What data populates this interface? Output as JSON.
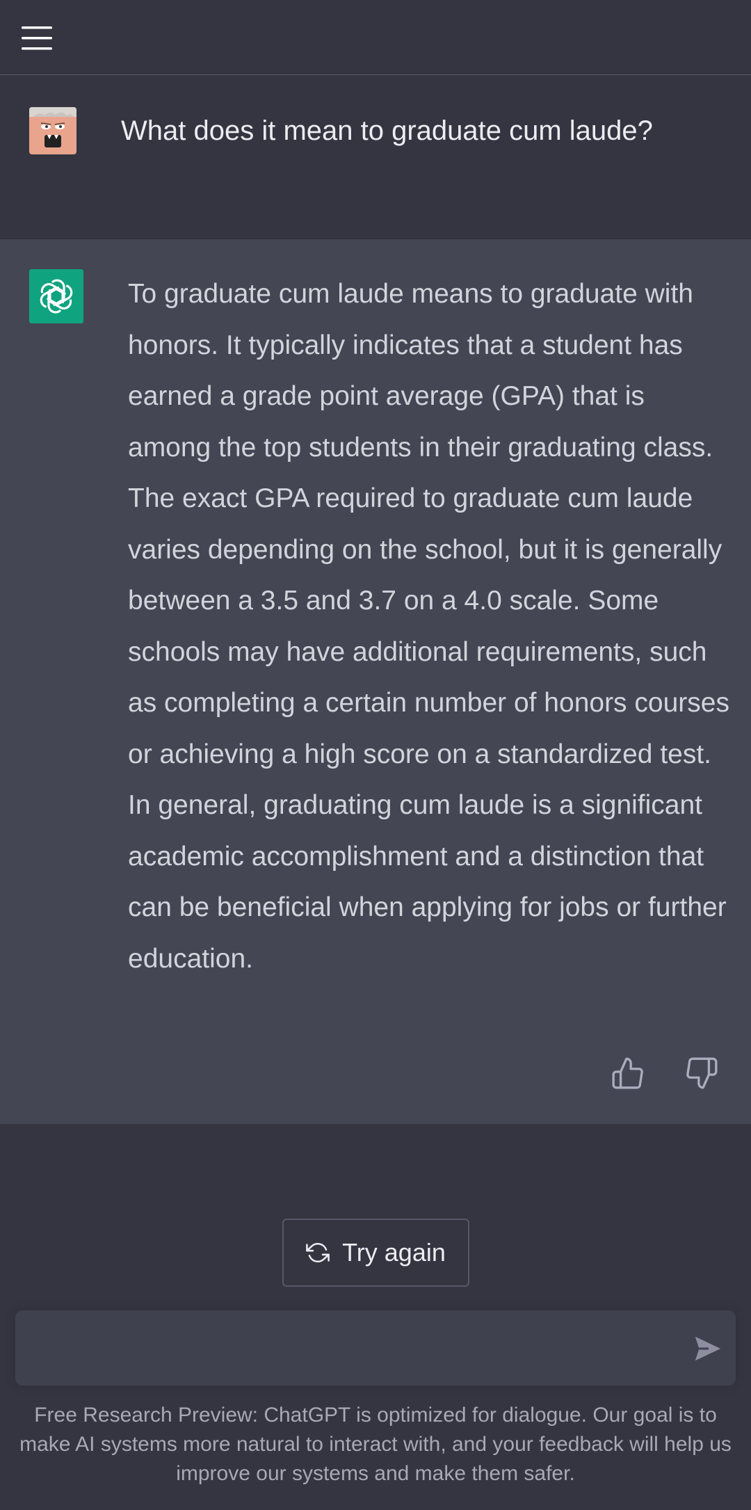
{
  "header": {
    "menu_icon": "hamburger-menu-icon"
  },
  "conversation": {
    "user_message": {
      "avatar": "user-avatar-cartoon",
      "text": "What does it mean to graduate cum laude?"
    },
    "assistant_message": {
      "avatar": "openai-logo-icon",
      "text": "To graduate cum laude means to graduate with honors. It typically indicates that a student has earned a grade point average (GPA) that is among the top students in their graduating class. The exact GPA required to graduate cum laude varies depending on the school, but it is generally between a 3.5 and 3.7 on a 4.0 scale. Some schools may have additional requirements, such as completing a certain number of honors courses or achieving a high score on a standardized test. In general, graduating cum laude is a significant academic accomplishment and a distinction that can be beneficial when applying for jobs or further education.",
      "feedback": {
        "thumbs_up_icon": "thumbs-up-icon",
        "thumbs_down_icon": "thumbs-down-icon"
      }
    }
  },
  "controls": {
    "try_again_label": "Try again",
    "input_placeholder": "",
    "send_icon": "send-icon"
  },
  "footer": {
    "disclaimer": "Free Research Preview: ChatGPT is optimized for dialogue. Our goal is to make AI systems more natural to interact with, and your feedback will help us improve our systems and make them safer."
  },
  "colors": {
    "background": "#343541",
    "assistant_background": "#444654",
    "brand_green": "#10a37f",
    "text": "#ececf1",
    "muted_text": "#a9a9b3"
  }
}
